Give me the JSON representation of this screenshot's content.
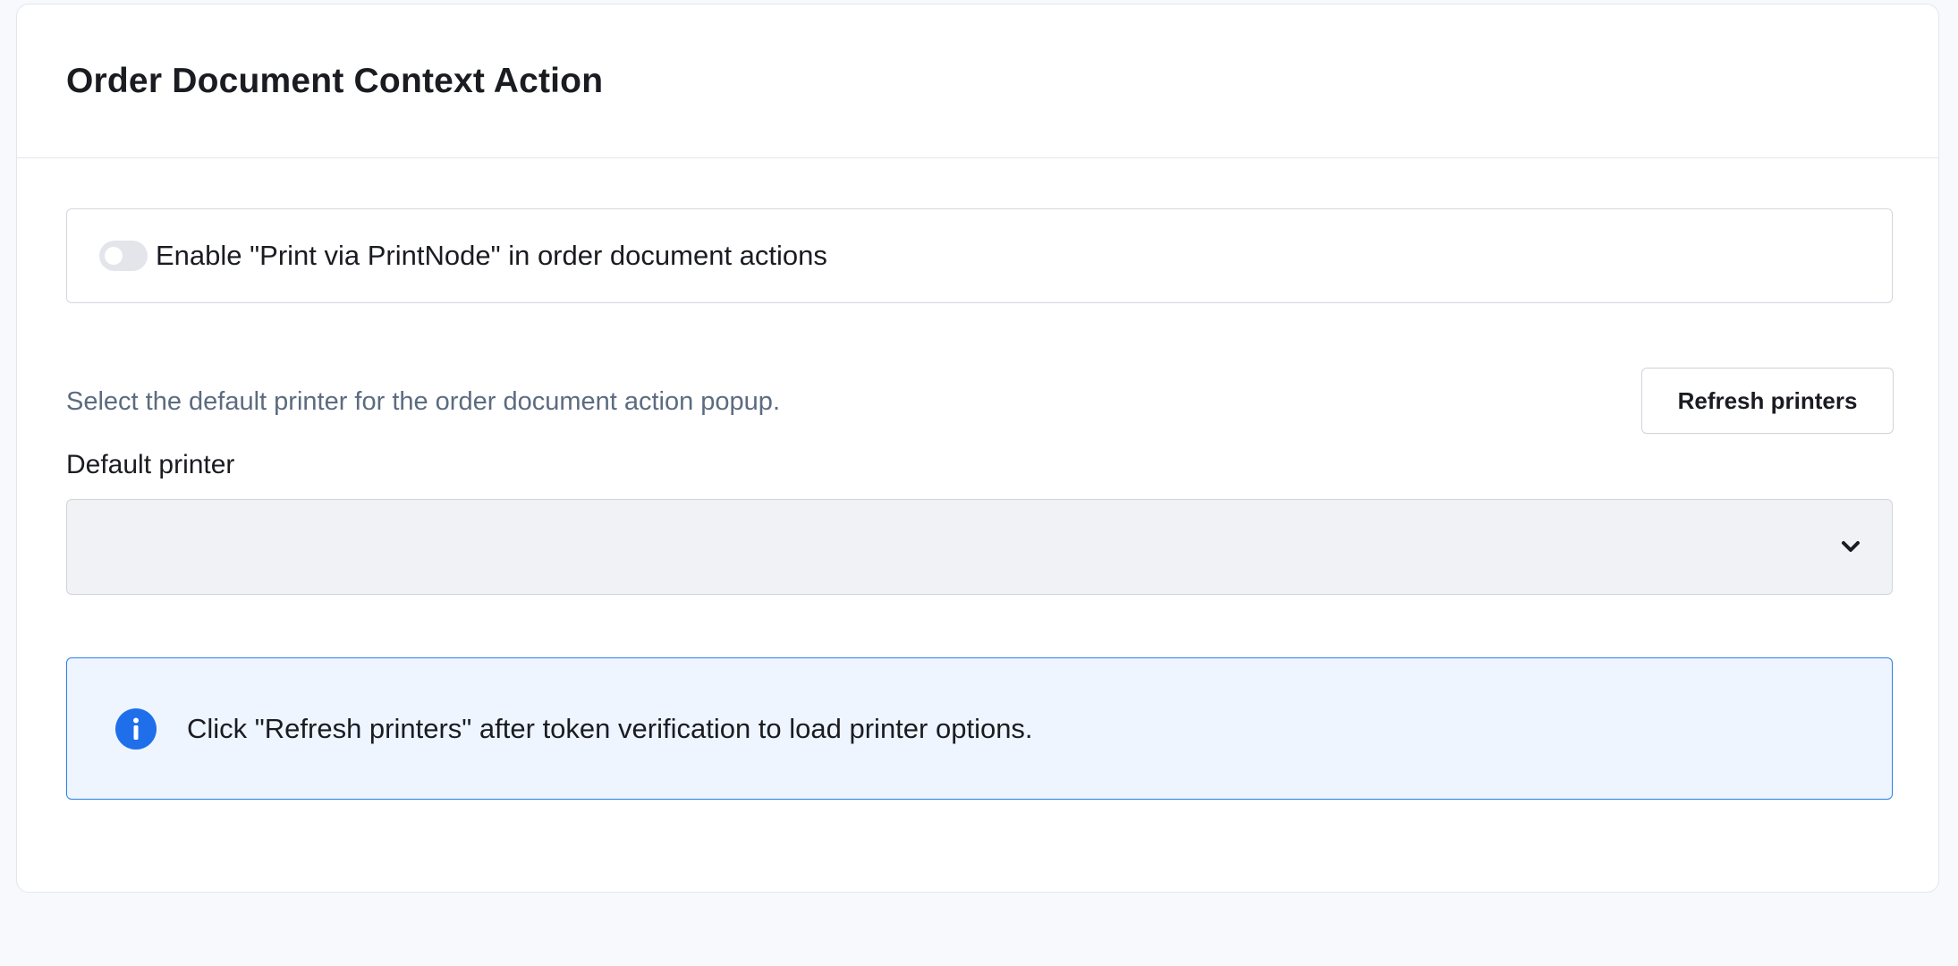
{
  "section": {
    "title": "Order Document Context Action"
  },
  "toggle": {
    "label": "Enable \"Print via PrintNode\" in order document actions",
    "enabled": false
  },
  "printer": {
    "help_text": "Select the default printer for the order document action popup.",
    "refresh_label": "Refresh printers",
    "field_label": "Default printer",
    "selected_value": ""
  },
  "info": {
    "message": "Click \"Refresh printers\" after token verification to load printer options."
  },
  "icons": {
    "toggle": "toggle-switch-off",
    "select": "chevron-down-icon",
    "info": "info-circle-icon"
  },
  "colors": {
    "info_accent": "#2b7de9",
    "info_background": "#eef5ff",
    "muted_text": "#5c6b80"
  }
}
